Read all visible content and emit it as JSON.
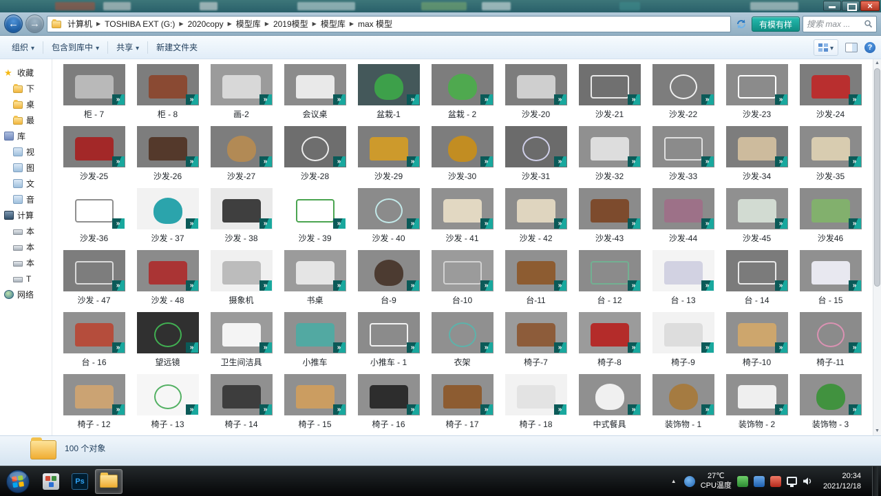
{
  "address": {
    "crumbs": [
      "计算机",
      "TOSHIBA EXT (G:)",
      "2020copy",
      "模型库",
      "2019模型",
      "模型库",
      "max 模型"
    ],
    "plugin_label": "有模有样",
    "search_placeholder": "搜索 max ..."
  },
  "toolbar": {
    "items": [
      {
        "label": "组织",
        "caret": true
      },
      {
        "label": "包含到库中",
        "caret": true
      },
      {
        "label": "共享",
        "caret": true
      },
      {
        "label": "新建文件夹",
        "caret": false
      }
    ]
  },
  "sidebar": {
    "items": [
      {
        "icon": "star",
        "label": "收藏",
        "indent": 0
      },
      {
        "icon": "folder",
        "label": "下",
        "indent": 1
      },
      {
        "icon": "folder",
        "label": "桌",
        "indent": 1
      },
      {
        "icon": "folder",
        "label": "最",
        "indent": 1
      },
      {
        "icon": "library",
        "label": "库",
        "indent": 0
      },
      {
        "icon": "video",
        "label": "视",
        "indent": 1
      },
      {
        "icon": "picture",
        "label": "图",
        "indent": 1
      },
      {
        "icon": "document",
        "label": "文",
        "indent": 1
      },
      {
        "icon": "music",
        "label": "音",
        "indent": 1
      },
      {
        "icon": "computer",
        "label": "计算",
        "indent": 0
      },
      {
        "icon": "drive",
        "label": "本",
        "indent": 1
      },
      {
        "icon": "drive",
        "label": "本",
        "indent": 1
      },
      {
        "icon": "drive",
        "label": "本",
        "indent": 1
      },
      {
        "icon": "drive",
        "label": "T",
        "indent": 1
      },
      {
        "icon": "network",
        "label": "网络",
        "indent": 0
      }
    ]
  },
  "files": [
    {
      "label": "柜 - 7",
      "bg": "#7d7d7d",
      "fg": "#b9b9b9",
      "s": "f"
    },
    {
      "label": "柜 - 8",
      "bg": "#7d7d7d",
      "fg": "#8a4a33",
      "s": "f"
    },
    {
      "label": "画-2",
      "bg": "#9b9b9b",
      "fg": "#d8d8d8",
      "s": "f"
    },
    {
      "label": "会议桌",
      "bg": "#8b8b8b",
      "fg": "#e9e9e9",
      "s": "f"
    },
    {
      "label": "盆栽-1",
      "bg": "#44585a",
      "fg": "#3da04a",
      "s": "r"
    },
    {
      "label": "盆栽 - 2",
      "bg": "#7d7d7d",
      "fg": "#4fa94f",
      "s": "r"
    },
    {
      "label": "沙发-20",
      "bg": "#7d7d7d",
      "fg": "#cfcfcf",
      "s": "f"
    },
    {
      "label": "沙发-21",
      "bg": "#707070",
      "fg": "#e9e9e9",
      "s": "w"
    },
    {
      "label": "沙发-22",
      "bg": "#7d7d7d",
      "fg": "#f0f0f0",
      "s": "o"
    },
    {
      "label": "沙发-23",
      "bg": "#8b8b8b",
      "fg": "#ffffff",
      "s": "w"
    },
    {
      "label": "沙发-24",
      "bg": "#7d7d7d",
      "fg": "#b92f2f",
      "s": "f"
    },
    {
      "label": "沙发-25",
      "bg": "#7d7d7d",
      "fg": "#a32828",
      "s": "f"
    },
    {
      "label": "沙发-26",
      "bg": "#7d7d7d",
      "fg": "#54392b",
      "s": "f"
    },
    {
      "label": "沙发-27",
      "bg": "#7d7d7d",
      "fg": "#b28a55",
      "s": "r"
    },
    {
      "label": "沙发-28",
      "bg": "#6e6e6e",
      "fg": "#ededed",
      "s": "o"
    },
    {
      "label": "沙发-29",
      "bg": "#7d7d7d",
      "fg": "#cd9a2c",
      "s": "f"
    },
    {
      "label": "沙发-30",
      "bg": "#7d7d7d",
      "fg": "#c28d22",
      "s": "r"
    },
    {
      "label": "沙发-31",
      "bg": "#6b6b6b",
      "fg": "#cfcfe9",
      "s": "o"
    },
    {
      "label": "沙发-32",
      "bg": "#909090",
      "fg": "#dddddd",
      "s": "f"
    },
    {
      "label": "沙发-33",
      "bg": "#8b8b8b",
      "fg": "#e0e0e0",
      "s": "w"
    },
    {
      "label": "沙发-34",
      "bg": "#7d7d7d",
      "fg": "#cdbb9d",
      "s": "f"
    },
    {
      "label": "沙发-35",
      "bg": "#8b8b8b",
      "fg": "#d8ccb0",
      "s": "f"
    },
    {
      "label": "沙发-36",
      "bg": "#ffffff",
      "fg": "#8f8f8f",
      "s": "w"
    },
    {
      "label": "沙发 - 37",
      "bg": "#f2f2f2",
      "fg": "#2ba4ac",
      "s": "r"
    },
    {
      "label": "沙发 - 38",
      "bg": "#e9e9e9",
      "fg": "#3f3f3f",
      "s": "f"
    },
    {
      "label": "沙发 - 39",
      "bg": "#ffffff",
      "fg": "#4aa450",
      "s": "w"
    },
    {
      "label": "沙发 - 40",
      "bg": "#8b8b8b",
      "fg": "#c2e9e9",
      "s": "o"
    },
    {
      "label": "沙发 - 41",
      "bg": "#909090",
      "fg": "#e2d8c2",
      "s": "f"
    },
    {
      "label": "沙发 - 42",
      "bg": "#8b8b8b",
      "fg": "#dfd5bf",
      "s": "f"
    },
    {
      "label": "沙发-43",
      "bg": "#8b8b8b",
      "fg": "#7d4b2d",
      "s": "f"
    },
    {
      "label": "沙发-44",
      "bg": "#8b8b8b",
      "fg": "#9d7188",
      "s": "f"
    },
    {
      "label": "沙发-45",
      "bg": "#909090",
      "fg": "#d2dbd2",
      "s": "f"
    },
    {
      "label": "沙发46",
      "bg": "#8b8b8b",
      "fg": "#82b06d",
      "s": "f"
    },
    {
      "label": "沙发 - 47",
      "bg": "#7d7d7d",
      "fg": "#dbdbdb",
      "s": "w"
    },
    {
      "label": "沙发 - 48",
      "bg": "#8b8b8b",
      "fg": "#aa3434",
      "s": "f"
    },
    {
      "label": "摄象机",
      "bg": "#f0f0f0",
      "fg": "#bcbcbc",
      "s": "f"
    },
    {
      "label": "书桌",
      "bg": "#9b9b9b",
      "fg": "#e5e5e5",
      "s": "f"
    },
    {
      "label": "台-9",
      "bg": "#8b8b8b",
      "fg": "#4c3b31",
      "s": "r"
    },
    {
      "label": "台-10",
      "bg": "#9b9b9b",
      "fg": "#d2d2d2",
      "s": "w"
    },
    {
      "label": "台-11",
      "bg": "#909090",
      "fg": "#8d5c31",
      "s": "f"
    },
    {
      "label": "台 - 12",
      "bg": "#8b8b8b",
      "fg": "#72b092",
      "s": "w"
    },
    {
      "label": "台 - 13",
      "bg": "#f4f4f4",
      "fg": "#d2d2e2",
      "s": "f"
    },
    {
      "label": "台 - 14",
      "bg": "#7b7b7b",
      "fg": "#eaeaea",
      "s": "w"
    },
    {
      "label": "台 - 15",
      "bg": "#909090",
      "fg": "#e8e8f0",
      "s": "f"
    },
    {
      "label": "台 - 16",
      "bg": "#909090",
      "fg": "#b54d3c",
      "s": "f"
    },
    {
      "label": "望远镜",
      "bg": "#303030",
      "fg": "#41b052",
      "s": "o"
    },
    {
      "label": "卫生间洁具",
      "bg": "#9b9b9b",
      "fg": "#f4f4f4",
      "s": "f"
    },
    {
      "label": "小推车",
      "bg": "#909090",
      "fg": "#52a9a2",
      "s": "f"
    },
    {
      "label": "小推车 - 1",
      "bg": "#8b8b8b",
      "fg": "#f2f2f2",
      "s": "w"
    },
    {
      "label": "衣架",
      "bg": "#909090",
      "fg": "#5cb3ab",
      "s": "o"
    },
    {
      "label": "椅子-7",
      "bg": "#9b9b9b",
      "fg": "#8d5c3a",
      "s": "f"
    },
    {
      "label": "椅子-8",
      "bg": "#9b9b9b",
      "fg": "#b42c2a",
      "s": "f"
    },
    {
      "label": "椅子-9",
      "bg": "#f2f2f2",
      "fg": "#dddddd",
      "s": "f"
    },
    {
      "label": "椅子-10",
      "bg": "#909090",
      "fg": "#cda66d",
      "s": "f"
    },
    {
      "label": "椅子-11",
      "bg": "#8b8b8b",
      "fg": "#db92b3",
      "s": "o"
    },
    {
      "label": "椅子 - 12",
      "bg": "#909090",
      "fg": "#cba373",
      "s": "f"
    },
    {
      "label": "椅子 - 13",
      "bg": "#f6f6f6",
      "fg": "#52b062",
      "s": "o"
    },
    {
      "label": "椅子 - 14",
      "bg": "#909090",
      "fg": "#3d3d3d",
      "s": "f"
    },
    {
      "label": "椅子 - 15",
      "bg": "#909090",
      "fg": "#cb9d61",
      "s": "f"
    },
    {
      "label": "椅子 - 16",
      "bg": "#909090",
      "fg": "#2d2d2d",
      "s": "f"
    },
    {
      "label": "椅子 - 17",
      "bg": "#909090",
      "fg": "#8d5c31",
      "s": "f"
    },
    {
      "label": "椅子 - 18",
      "bg": "#f2f2f2",
      "fg": "#e3e3e3",
      "s": "f"
    },
    {
      "label": "中式餐具",
      "bg": "#909090",
      "fg": "#f0f0f0",
      "s": "r"
    },
    {
      "label": "装饰物 - 1",
      "bg": "#909090",
      "fg": "#a57b41",
      "s": "r"
    },
    {
      "label": "装饰物 - 2",
      "bg": "#909090",
      "fg": "#efefef",
      "s": "f"
    },
    {
      "label": "装饰物 - 3",
      "bg": "#909090",
      "fg": "#41923f",
      "s": "r"
    }
  ],
  "statusbar": {
    "count_text": "100 个对象"
  },
  "taskbar": {
    "apps": [
      {
        "name": "app"
      },
      {
        "name": "photoshop",
        "label": "Ps"
      },
      {
        "name": "explorer"
      }
    ],
    "tray": {
      "temp": "27℃",
      "temp_label": "CPU温度",
      "time": "20:34",
      "date": "2021/12/18"
    }
  },
  "colors": {
    "accent_teal": "#19a89e",
    "aero_chrome": "#a3bed1",
    "close_red": "#c9452f"
  }
}
